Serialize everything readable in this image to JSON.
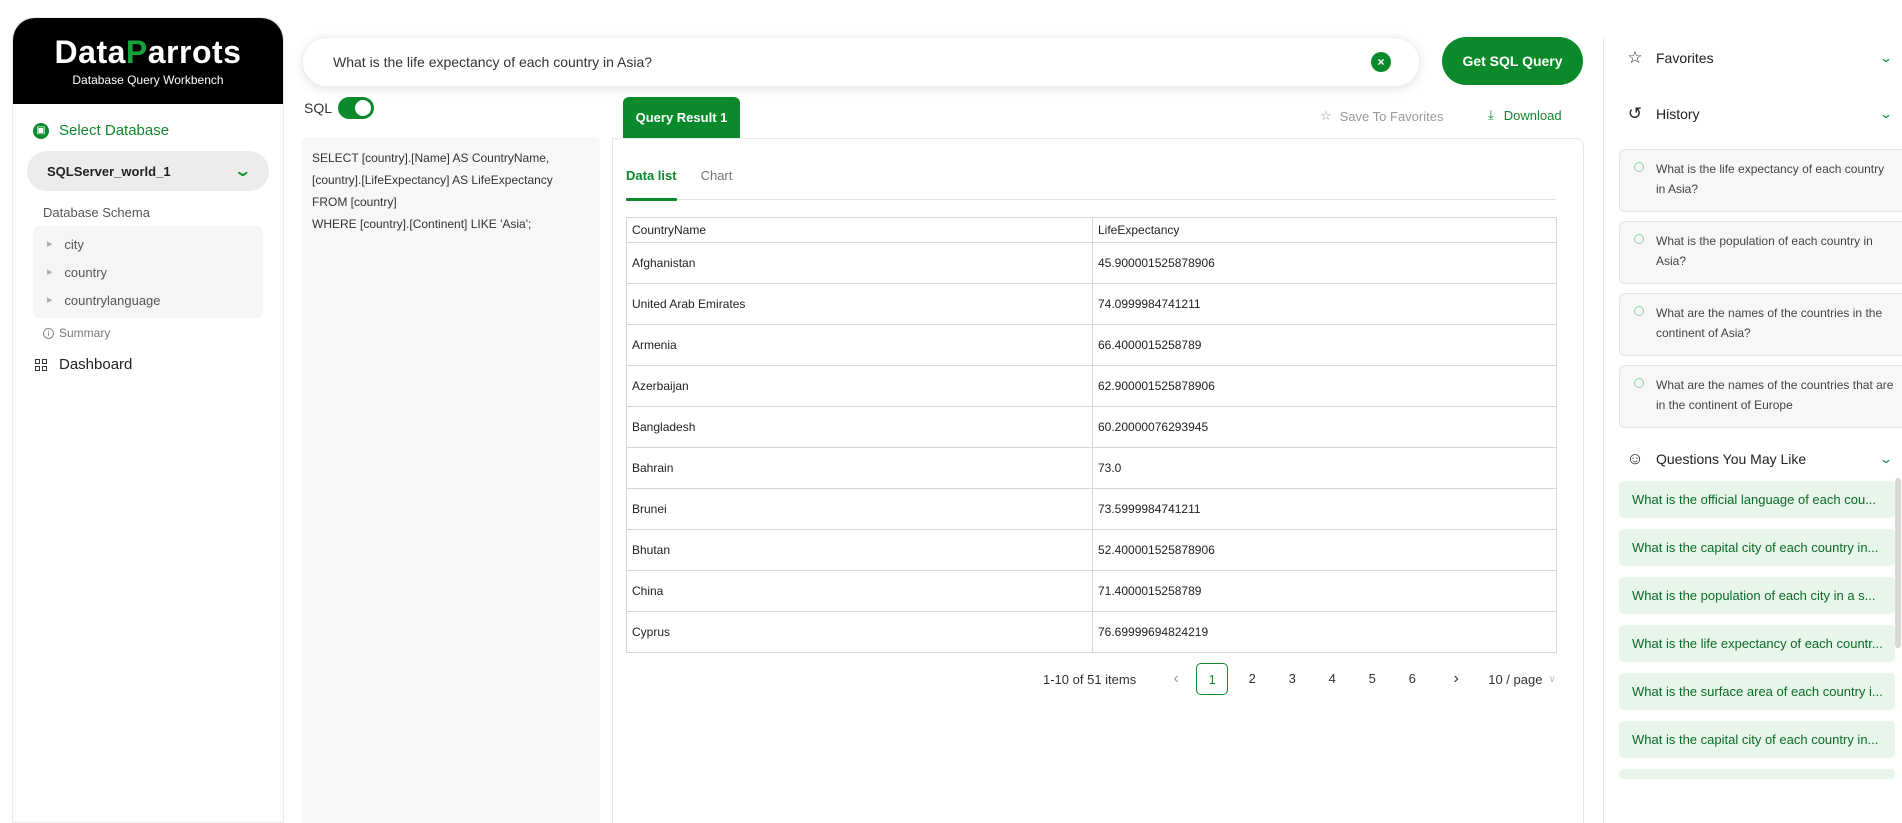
{
  "brand": {
    "name_main": "Data",
    "name_accent": "P",
    "name_rest": "arrots",
    "subtitle": "Database Query Workbench"
  },
  "sidebar": {
    "select_db_label": "Select Database",
    "selected_db": "SQLServer_world_1",
    "schema_title": "Database Schema",
    "schema_items": [
      "city",
      "country",
      "countrylanguage"
    ],
    "summary_label": "Summary",
    "dashboard_label": "Dashboard"
  },
  "search": {
    "value": "What is the life expectancy of each country in Asia?",
    "button_label": "Get SQL Query"
  },
  "sql": {
    "toggle_label": "SQL",
    "toggle_on": true,
    "lines": [
      "SELECT [country].[Name] AS CountryName,",
      "[country].[LifeExpectancy] AS LifeExpectancy",
      "FROM [country]",
      "WHERE [country].[Continent] LIKE 'Asia';"
    ]
  },
  "result": {
    "tab_label": "Query Result 1",
    "save_label": "Save To Favorites",
    "download_label": "Download",
    "subtabs": [
      "Data list",
      "Chart"
    ],
    "columns": [
      "CountryName",
      "LifeExpectancy"
    ],
    "rows": [
      [
        "Afghanistan",
        "45.900001525878906"
      ],
      [
        "United Arab Emirates",
        "74.0999984741211"
      ],
      [
        "Armenia",
        "66.4000015258789"
      ],
      [
        "Azerbaijan",
        "62.900001525878906"
      ],
      [
        "Bangladesh",
        "60.20000076293945"
      ],
      [
        "Bahrain",
        "73.0"
      ],
      [
        "Brunei",
        "73.5999984741211"
      ],
      [
        "Bhutan",
        "52.400001525878906"
      ],
      [
        "China",
        "71.4000015258789"
      ],
      [
        "Cyprus",
        "76.69999694824219"
      ]
    ],
    "pagination": {
      "total_text": "1-10 of 51 items",
      "pages": [
        "1",
        "2",
        "3",
        "4",
        "5",
        "6"
      ],
      "current": "1",
      "page_size": "10 / page"
    }
  },
  "right": {
    "favorites_label": "Favorites",
    "history_label": "History",
    "history_items": [
      "What is the life expectancy of each country in Asia?",
      "What is the population of each country in Asia?",
      "What are the names of the countries in the continent of Asia?",
      "What are the names of the countries that are in the continent of Europe"
    ],
    "questions_label": "Questions You May Like",
    "questions": [
      "What is the official language of each cou...",
      "What is the capital city of each country in...",
      "What is the population of each city in a s...",
      "What is the life expectancy of each countr...",
      "What is the surface area of each country i...",
      "What is the capital city of each country in..."
    ]
  },
  "colors": {
    "accent": "#0b8a2b",
    "brand_bg": "#000000",
    "question_bg": "#e7f5ea"
  }
}
